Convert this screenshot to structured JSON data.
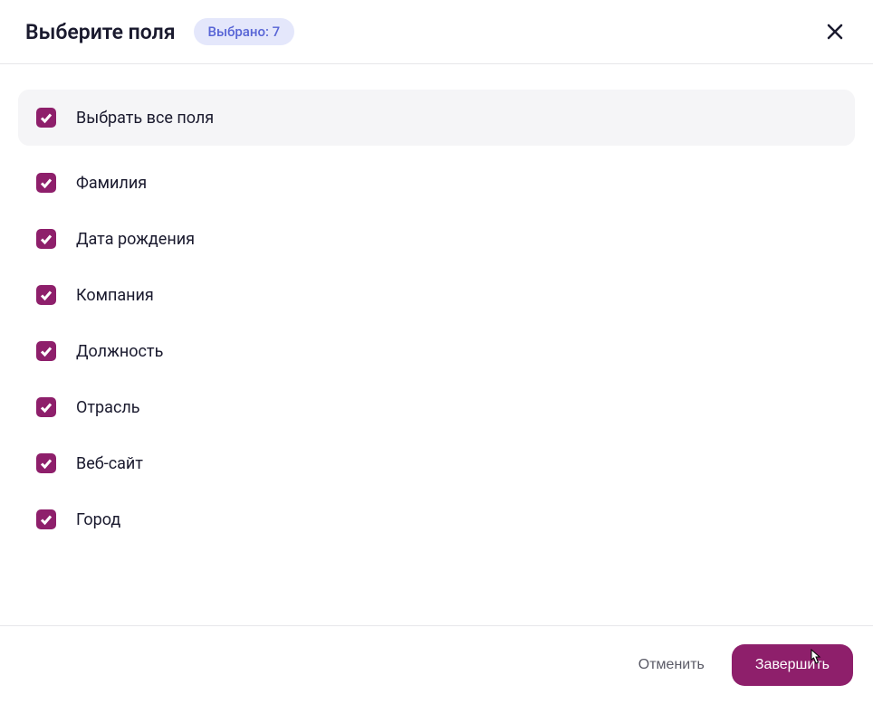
{
  "header": {
    "title": "Выберите поля",
    "badge": "Выбрано: 7"
  },
  "fields": {
    "select_all_label": "Выбрать все поля",
    "items": [
      {
        "label": "Фамилия"
      },
      {
        "label": "Дата рождения"
      },
      {
        "label": "Компания"
      },
      {
        "label": "Должность"
      },
      {
        "label": "Отрасль"
      },
      {
        "label": "Веб-сайт"
      },
      {
        "label": "Город"
      }
    ]
  },
  "footer": {
    "cancel_label": "Отменить",
    "submit_label": "Завершить"
  },
  "colors": {
    "accent": "#8e1f6b",
    "badge_bg": "#e4e7fb",
    "badge_text": "#5865d6"
  }
}
